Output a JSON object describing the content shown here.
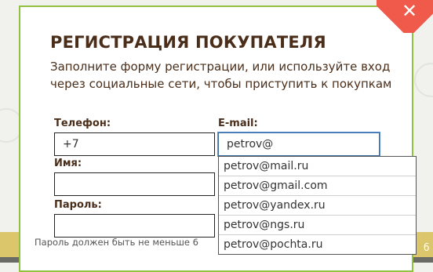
{
  "dialog": {
    "title": "РЕГИСТРАЦИЯ ПОКУПАТЕЛЯ",
    "subtitle": "Заполните форму регистрации, или используйте вход через социальные сети, чтобы приступить к покупкам",
    "close_icon": "close-icon",
    "accent_color": "#8fc240",
    "close_color": "#f05a4a",
    "text_color": "#4a2e1a"
  },
  "form": {
    "phone": {
      "label": "Телефон:",
      "value": "+7"
    },
    "email": {
      "label": "E-mail:",
      "value": "petrov@"
    },
    "name": {
      "label": "Имя:",
      "value": ""
    },
    "password": {
      "label": "Пароль:",
      "value": "",
      "hint": "Пароль должен быть не меньше 6"
    }
  },
  "autocomplete": {
    "options": [
      "petrov@mail.ru",
      "petrov@gmail.com",
      "petrov@yandex.ru",
      "petrov@ngs.ru",
      "petrov@pochta.ru"
    ]
  },
  "background": {
    "edge_text": "б"
  }
}
